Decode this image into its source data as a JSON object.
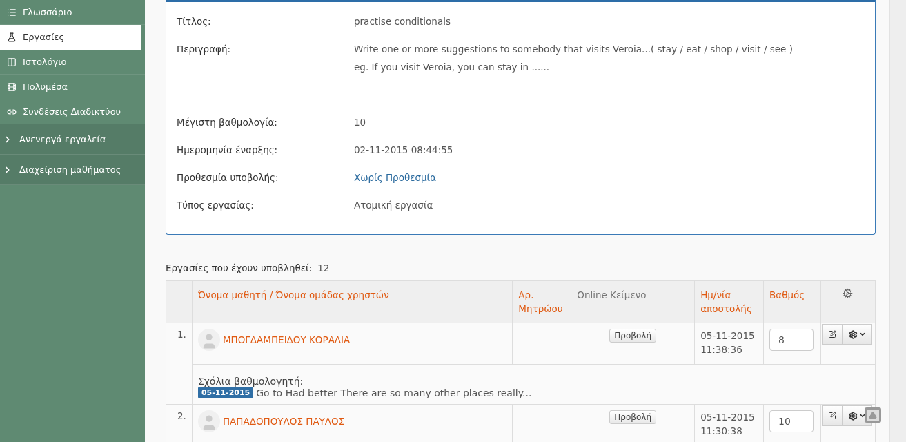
{
  "sidebar": {
    "items": [
      {
        "label": "Γλωσσάριο",
        "selected": false
      },
      {
        "label": "Εργασίες",
        "selected": true
      },
      {
        "label": "Ιστολόγιο",
        "selected": false
      },
      {
        "label": "Πολυμέσα",
        "selected": false
      },
      {
        "label": "Συνδέσεις Διαδικτύου",
        "selected": false
      }
    ],
    "sections": [
      {
        "label": "Ανενεργά εργαλεία",
        "expanded": false
      },
      {
        "label": "Διαχείριση μαθήματος",
        "expanded": false
      }
    ]
  },
  "details": [
    {
      "label": "Τίτλος:",
      "kind": "text",
      "lines": [
        "practise conditionals"
      ]
    },
    {
      "label": "Περιγραφή:",
      "kind": "text",
      "lines": [
        "Write one or more suggestions to somebody that visits Veroia...( stay / eat / shop / visit / see )",
        "eg. If you visit Veroia, you can stay in ......"
      ]
    },
    {
      "label": "Μέγιστη βαθμολογία:",
      "kind": "text",
      "lines": [
        "10"
      ]
    },
    {
      "label": "Ημερομηνία έναρξης:",
      "kind": "text",
      "lines": [
        "02-11-2015 08:44:55"
      ]
    },
    {
      "label": "Προθεσμία υποβολής:",
      "kind": "link",
      "lines": [
        "Χωρίς Προθεσμία"
      ]
    },
    {
      "label": "Τύπος εργασίας:",
      "kind": "text",
      "lines": [
        "Ατομική εργασία"
      ]
    }
  ],
  "submissions": {
    "label": "Εργασίες που έχουν υποβληθεί:",
    "count": "12",
    "columns": [
      {
        "label": "Όνομα μαθητή / Όνομα ομάδας χρηστών",
        "sortable": true
      },
      {
        "label": "Αρ. Μητρώου",
        "sortable": true
      },
      {
        "label": "Online Κείμενο",
        "sortable": false
      },
      {
        "label": "Ημ/νία αποστολής",
        "sortable": true
      },
      {
        "label": "Βαθμός",
        "sortable": true
      }
    ],
    "rows": [
      {
        "number": "1.",
        "name": "ΜΠΟΓΔΑΜΠΕΙΔΟΥ ΚΟΡΑΛΙΑ",
        "view": "Προβολή",
        "date": "05-11-2015",
        "time": "11:38:36",
        "grade": "8",
        "comments": {
          "label": "Σχόλια βαθμολογητή:",
          "date": "05-11-2015",
          "text": "Go to Had better There are so many other places really..."
        }
      },
      {
        "number": "2.",
        "name": "ΠΑΠΑΔΟΠΟΥΛΟΣ ΠΑΥΛΟΣ",
        "view": "Προβολή",
        "date": "05-11-2015",
        "time": "11:30:38",
        "grade": "10"
      }
    ]
  }
}
